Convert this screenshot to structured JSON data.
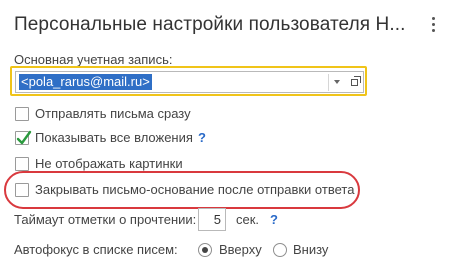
{
  "window": {
    "title": "Персональные настройки пользователя Н..."
  },
  "account": {
    "label": "Основная учетная запись:",
    "value": "<pola_rarus@mail.ru>"
  },
  "options": [
    {
      "label": "Отправлять письма сразу",
      "checked": false
    },
    {
      "label": "Показывать все вложения",
      "checked": true,
      "help": "?"
    },
    {
      "label": "Не отображать картинки",
      "checked": false
    },
    {
      "label": "Закрывать письмо-основание после отправки ответа",
      "checked": false,
      "highlighted": true
    }
  ],
  "read_timeout": {
    "label": "Таймаут отметки о прочтении:",
    "value": "5",
    "unit": "сек.",
    "help": "?"
  },
  "autofocus": {
    "label": "Автофокус в списке писем:",
    "options": [
      {
        "label": "Вверху",
        "selected": true
      },
      {
        "label": "Внизу",
        "selected": false
      }
    ]
  },
  "colors": {
    "accent": "#2f6fc6",
    "focus_frame": "#f0c419",
    "highlight": "#d9393e",
    "checkmark": "#2b9a3e",
    "help": "#2a6ac8"
  }
}
